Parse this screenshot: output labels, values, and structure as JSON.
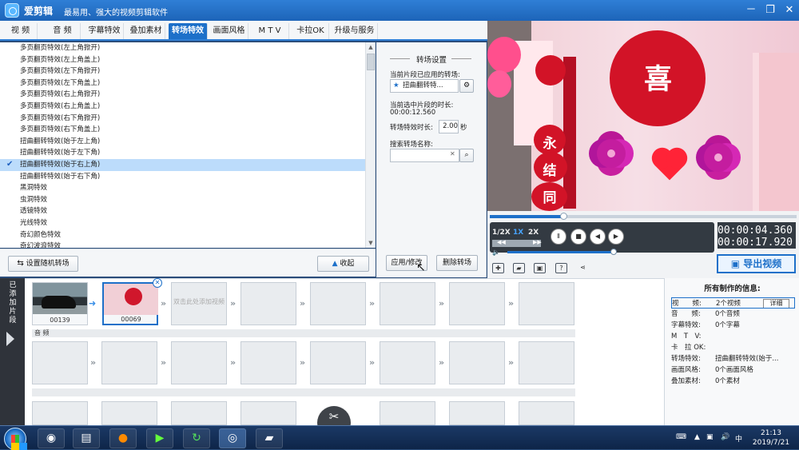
{
  "window": {
    "title": "爱剪辑",
    "subtitle": "最易用、强大的视频剪辑软件",
    "controls": [
      "－",
      "❐",
      "✕"
    ]
  },
  "tabs": [
    {
      "label": "视 频",
      "active": false
    },
    {
      "label": "音 频",
      "active": false
    },
    {
      "label": "字幕特效",
      "active": false
    },
    {
      "label": "叠加素材",
      "active": false
    },
    {
      "label": "转场特效",
      "active": true
    },
    {
      "label": "画面风格",
      "active": false
    },
    {
      "label": "M T V",
      "active": false
    },
    {
      "label": "卡拉OK",
      "active": false
    },
    {
      "label": "升级与服务",
      "active": false
    }
  ],
  "effects": [
    {
      "name": "多页翻页特效(左上角掀开)",
      "selected": false
    },
    {
      "name": "多页翻页特效(左上角盖上)",
      "selected": false
    },
    {
      "name": "多页翻页特效(左下角掀开)",
      "selected": false
    },
    {
      "name": "多页翻页特效(左下角盖上)",
      "selected": false
    },
    {
      "name": "多页翻页特效(右上角掀开)",
      "selected": false
    },
    {
      "name": "多页翻页特效(右上角盖上)",
      "selected": false
    },
    {
      "name": "多页翻页特效(右下角掀开)",
      "selected": false
    },
    {
      "name": "多页翻页特效(右下角盖上)",
      "selected": false
    },
    {
      "name": "扭曲翻转特效(始于左上角)",
      "selected": false
    },
    {
      "name": "扭曲翻转特效(始于左下角)",
      "selected": false
    },
    {
      "name": "扭曲翻转特效(始于右上角)",
      "selected": true
    },
    {
      "name": "扭曲翻转特效(始于右下角)",
      "selected": false
    },
    {
      "name": "黑洞特效",
      "selected": false
    },
    {
      "name": "虫洞特效",
      "selected": false
    },
    {
      "name": "透镜特效",
      "selected": false
    },
    {
      "name": "光线特效",
      "selected": false
    },
    {
      "name": "奇幻颜色特效",
      "selected": false
    },
    {
      "name": "奇幻波浪特效",
      "selected": false
    }
  ],
  "listButtons": {
    "random": "设置随机转场",
    "collapse": "收起"
  },
  "settings": {
    "title": "转场设置",
    "appliedLabel": "当前片段已应用的转场:",
    "appliedValue": "扭曲翻转特...",
    "durationLabel": "当前选中片段的时长:",
    "durationValue": "00:00:12.560",
    "effectDurationLabel": "转场特效时长:",
    "effectDurationValue": "2.00",
    "effectDurationUnit": "秒",
    "searchLabel": "搜索转场名称:",
    "searchValue": "",
    "searchClear": "✕",
    "applyButton": "应用/修改",
    "deleteButton": "删除转场"
  },
  "preview": {
    "chars": [
      "喜",
      "永",
      "结",
      "同"
    ]
  },
  "player": {
    "speeds": [
      "1/2X",
      "1X",
      "2X"
    ],
    "currentSpeed": "1X",
    "progress": 0.24,
    "volume": 1.0,
    "currentTime": "00:00:04.360",
    "totalTime": "00:00:17.920",
    "exportLabel": "导出视频"
  },
  "timeline": {
    "sideLabel": "已添加片段",
    "clips": [
      {
        "label": "00139",
        "kind": "car"
      },
      {
        "label": "00069",
        "kind": "wedding"
      }
    ],
    "emptyText": "双击此处添加视频",
    "audioLabel": "音 频"
  },
  "info": {
    "title": "所有制作的信息:",
    "detailButton": "详细",
    "rows": [
      {
        "key": "视　　频:",
        "value": "2个视频"
      },
      {
        "key": "音　　频:",
        "value": "0个音频"
      },
      {
        "key": "字幕特效:",
        "value": "0个字幕"
      },
      {
        "key": "M　T　V:",
        "value": ""
      },
      {
        "key": "卡　拉 OK:",
        "value": ""
      },
      {
        "key": "转场特效:",
        "value": "扭曲翻转特效(始于..."
      },
      {
        "key": "画面风格:",
        "value": "0个画面风格"
      },
      {
        "key": "叠加素材:",
        "value": "0个素材"
      }
    ]
  },
  "taskbar": {
    "time": "21:13",
    "date": "2019/7/21"
  },
  "colors": {
    "accent": "#1d70c9",
    "selected": "#bcdcfb",
    "playerDark": "#333a42"
  }
}
